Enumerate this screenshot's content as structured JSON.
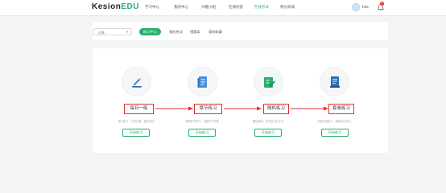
{
  "header": {
    "logo_main": "Kesion",
    "logo_accent": "EDU",
    "nav": [
      {
        "label": "学习中心"
      },
      {
        "label": "我的中心"
      },
      {
        "label": "兴趣小组"
      },
      {
        "label": "在线问答"
      },
      {
        "label": "在线考试"
      },
      {
        "label": "积分商城"
      }
    ],
    "user_name": "Tina",
    "notification_count": "3"
  },
  "filters": {
    "subject_value": "日本",
    "tabs": [
      {
        "label": "练习中心"
      },
      {
        "label": "我的考试"
      },
      {
        "label": "错题本"
      },
      {
        "label": "我的收藏"
      }
    ]
  },
  "practice": {
    "items": [
      {
        "title": "每日一练",
        "desc": "每日练习，日积月累，提高成绩",
        "button": "开始练习",
        "icon": "pen-icon"
      },
      {
        "title": "章节练习",
        "desc": "按照章节练习，巩固学习成果",
        "button": "开始练习",
        "icon": "book-icon"
      },
      {
        "title": "随机练习",
        "desc": "随机组卷，考考自己的水平",
        "button": "开始练习",
        "icon": "edit-icon"
      },
      {
        "title": "套卷练习",
        "desc": "完整试卷练习，模拟真实考试",
        "button": "开始练习",
        "icon": "paper-icon"
      }
    ]
  },
  "colors": {
    "accent": "#26b06e",
    "highlight": "#e03030"
  }
}
